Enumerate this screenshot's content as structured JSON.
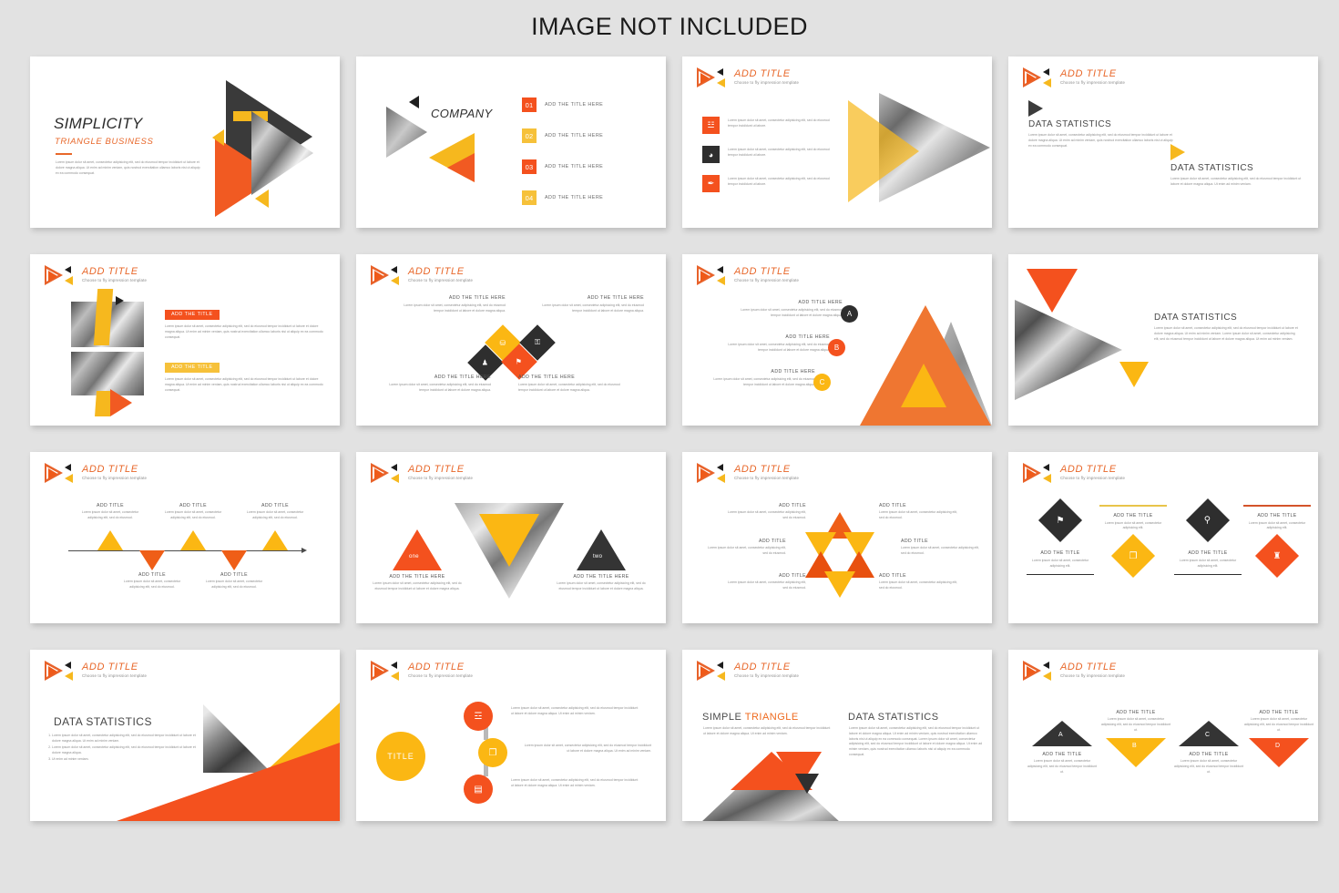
{
  "header": {
    "title": "IMAGE NOT INCLUDED"
  },
  "brand": {
    "logo_title": "ADD TITLE",
    "logo_sub": "Choose to fly impression template",
    "colors": {
      "orange": "#f4511e",
      "orange_light": "#ef7631",
      "yellow": "#fbb713",
      "yellow_soft": "#f6b81e",
      "dark": "#343434",
      "grey_text": "#8e8e8e",
      "slide_bg": "#ffffff",
      "page_bg": "#e2e2e2"
    }
  },
  "lorem": {
    "xs": "Lorem ipsum dolor sit amet, consectetur adipisicing elit, sed do eiusmod tempor incididunt ut labore et dolore magna aliqua.",
    "short": "Lorem ipsum dolor sit amet, consectetur adipisicing elit, sed do eiusmod.",
    "med": "Lorem ipsum dolor sit amet, consectetur adipisicing elit, sed do eiusmod tempor incididunt ut labore et dolore magna aliqua. Ut enim ad minim veniam.",
    "long": "Lorem ipsum dolor sit amet, consectetur adipisicing elit, sed do eiusmod tempor incididunt ut labore et dolore magna aliqua. Ut enim ad minim veniam, quis nostrud exercitation ullamco laboris nisi ut aliquip ex ea commodo consequat.",
    "tiny": "Lorem ipsum dolor sit amet, consectetur adipisicing elit, sed do eiusmod."
  },
  "slides": [
    {
      "id": "s1-title-slide",
      "title": "SIMPLICITY",
      "subtitle": "TRIANGLE BUSINESS",
      "body": "Lorem ipsum dolor sit amet, consectetur adipisicing elit, sed do eiusmod tempor incididunt ut labore et dolore magna aliqua. Ut enim ad minim veniam, quis nostrud exercitation ullamco laboris nisi ut aliquip ex ea commodo consequat."
    },
    {
      "id": "s2-company-agenda",
      "company": "COMPANY",
      "items": [
        {
          "num": "01",
          "label": "ADD THE TITLE HERE",
          "color": "#f4511e"
        },
        {
          "num": "02",
          "label": "ADD THE TITLE HERE",
          "color": "#f6c13a"
        },
        {
          "num": "03",
          "label": "ADD THE TITLE HERE",
          "color": "#f4511e"
        },
        {
          "num": "04",
          "label": "ADD THE TITLE HERE",
          "color": "#f6c13a"
        }
      ]
    },
    {
      "id": "s3-icon-list",
      "rows": [
        {
          "icon": "chart-icon",
          "glyph": "☳",
          "color": "#f4511e",
          "text": "Lorem ipsum dolor sit amet, consectetur adipisicing elit, sed do eiusmod tempor incididunt ut labore."
        },
        {
          "icon": "paint-bucket-icon",
          "glyph": "◕",
          "color": "#2e2e2e",
          "text": "Lorem ipsum dolor sit amet, consectetur adipisicing elit, sed do eiusmod tempor incididunt ut labore."
        },
        {
          "icon": "pen-icon",
          "glyph": "✒",
          "color": "#f4511e",
          "text": "Lorem ipsum dolor sit amet, consectetur adipisicing elit, sed do eiusmod tempor incididunt ut labore."
        }
      ]
    },
    {
      "id": "s4-data-statistics-dual",
      "block_a": {
        "heading": "DATA STATISTICS",
        "text": "Lorem ipsum dolor sit amet, consectetur adipisicing elit, sed do eiusmod tempor incididunt ut labore et dolore magna aliqua. Ut enim ad minim veniam, quis nostrud exercitation ullamco laboris nisi ut aliquip ex ea commodo consequat."
      },
      "block_b": {
        "heading": "DATA STATISTICS",
        "text": "Lorem ipsum dolor sit amet, consectetur adipisicing elit, sed do eiusmod tempor incididunt ut labore et dolore magna aliqua. Ut enim ad minim veniam."
      }
    },
    {
      "id": "s5-image-text",
      "blocks": [
        {
          "tag": "ADD THE TITLE",
          "tag_color": "#f4511e",
          "text": "Lorem ipsum dolor sit amet, consectetur adipisicing elit, sed do eiusmod tempor incididunt ut labore et dolore magna aliqua. Ut enim ad minim veniam, quis nostrud exercitation ullamco laboris nisi ut aliquip ex ea commodo consequat."
        },
        {
          "tag": "ADD THE TITLE",
          "tag_color": "#f6c13a",
          "text": "Lorem ipsum dolor sit amet, consectetur adipisicing elit, sed do eiusmod tempor incididunt ut labore et dolore magna aliqua. Ut enim ad minim veniam, quis nostrud exercitation ullamco laboris nisi ut aliquip ex ea commodo consequat."
        }
      ]
    },
    {
      "id": "s6-diamond-quad",
      "captions": [
        {
          "heading": "ADD THE TITLE HERE",
          "text": "Lorem ipsum dolor sit amet, consectetur adipisicing elit, sed do eiusmod tempor incididunt ut labore et dolore magna aliqua."
        },
        {
          "heading": "ADD THE TITLE HERE",
          "text": "Lorem ipsum dolor sit amet, consectetur adipisicing elit, sed do eiusmod tempor incididunt ut labore et dolore magna aliqua."
        },
        {
          "heading": "ADD THE TITLE HERE",
          "text": "Lorem ipsum dolor sit amet, consectetur adipisicing elit, sed do eiusmod tempor incididunt ut labore et dolore magna aliqua."
        },
        {
          "heading": "ADD THE TITLE HERE",
          "text": "Lorem ipsum dolor sit amet, consectetur adipisicing elit, sed do eiusmod tempor incididunt ut labore et dolore magna aliqua."
        }
      ],
      "diamonds": [
        {
          "icon": "briefcase-icon",
          "glyph": "⛁",
          "color": "#fbb713"
        },
        {
          "icon": "lock-icon",
          "glyph": "⚿",
          "color": "#2e2e2e"
        },
        {
          "icon": "user-icon",
          "glyph": "♟",
          "color": "#2e2e2e"
        },
        {
          "icon": "presentation-icon",
          "glyph": "⚑",
          "color": "#f4511e"
        }
      ]
    },
    {
      "id": "s7-abc-triangle",
      "rows": [
        {
          "badge": "A",
          "color": "#2e2e2e",
          "heading": "ADD TITLE HERE",
          "text": "Lorem ipsum dolor sit amet, consectetur adipisicing elit, sed do eiusmod tempor incididunt ut labore et dolore magna aliqua."
        },
        {
          "badge": "B",
          "color": "#f4511e",
          "heading": "ADD TITLE HERE",
          "text": "Lorem ipsum dolor sit amet, consectetur adipisicing elit, sed do eiusmod tempor incididunt ut labore et dolore magna aliqua."
        },
        {
          "badge": "C",
          "color": "#fbb713",
          "heading": "ADD TITLE HERE",
          "text": "Lorem ipsum dolor sit amet, consectetur adipisicing elit, sed do eiusmod tempor incididunt ut labore et dolore magna aliqua."
        }
      ]
    },
    {
      "id": "s8-data-statistics-photo",
      "heading": "DATA STATISTICS",
      "text": "Lorem ipsum dolor sit amet, consectetur adipisicing elit, sed do eiusmod tempor incididunt ut labore et dolore magna aliqua. Ut enim ad minim veniam. Lorem ipsum dolor sit amet, consectetur adipisicing elit, sed do eiusmod tempor incididunt ut labore et dolore magna aliqua. Ut enim ad minim veniam."
    },
    {
      "id": "s9-timeline",
      "above": [
        {
          "heading": "ADD TITLE",
          "text": "Lorem ipsum dolor sit amet, consectetur adipisicing elit, sed do eiusmod."
        },
        {
          "heading": "ADD TITLE",
          "text": "Lorem ipsum dolor sit amet, consectetur adipisicing elit, sed do eiusmod."
        },
        {
          "heading": "ADD TITLE",
          "text": "Lorem ipsum dolor sit amet, consectetur adipisicing elit, sed do eiusmod."
        }
      ],
      "below": [
        {
          "heading": "ADD TITLE",
          "text": "Lorem ipsum dolor sit amet, consectetur adipisicing elit, sed do eiusmod."
        },
        {
          "heading": "ADD TITLE",
          "text": "Lorem ipsum dolor sit amet, consectetur adipisicing elit, sed do eiusmod."
        }
      ]
    },
    {
      "id": "s10-one-two",
      "left": {
        "label": "one",
        "heading": "ADD THE TITLE HERE",
        "text": "Lorem ipsum dolor sit amet, consectetur adipisicing elit, sed do eiusmod tempor incididunt ut labore et dolore magna aliqua."
      },
      "right": {
        "label": "two",
        "heading": "ADD THE TITLE HERE",
        "text": "Lorem ipsum dolor sit amet, consectetur adipisicing elit, sed do eiusmod tempor incididunt ut labore et dolore magna aliqua."
      }
    },
    {
      "id": "s11-star-six",
      "left": [
        {
          "heading": "ADD TITLE",
          "text": "Lorem ipsum dolor sit amet, consectetur adipisicing elit, sed do eiusmod."
        },
        {
          "heading": "ADD TITLE",
          "text": "Lorem ipsum dolor sit amet, consectetur adipisicing elit, sed do eiusmod."
        },
        {
          "heading": "ADD TITLE",
          "text": "Lorem ipsum dolor sit amet, consectetur adipisicing elit, sed do eiusmod."
        }
      ],
      "right": [
        {
          "heading": "ADD TITLE",
          "text": "Lorem ipsum dolor sit amet, consectetur adipisicing elit, sed do eiusmod."
        },
        {
          "heading": "ADD TITLE",
          "text": "Lorem ipsum dolor sit amet, consectetur adipisicing elit, sed do eiusmod."
        },
        {
          "heading": "ADD TITLE",
          "text": "Lorem ipsum dolor sit amet, consectetur adipisicing elit, sed do eiusmod."
        }
      ]
    },
    {
      "id": "s12-diamond-row",
      "cells": [
        {
          "icon": "flag-icon",
          "glyph": "⚑",
          "dia_color": "#2e2e2e",
          "rule_color": "#2e2e2e",
          "heading": "ADD THE TITLE",
          "text": "Lorem ipsum dolor sit amet, consectetur adipisicing elit.",
          "orient": "up"
        },
        {
          "icon": "laptop-icon",
          "glyph": "❐",
          "dia_color": "#fbb713",
          "rule_color": "#e8c44a",
          "heading": "ADD THE TITLE",
          "text": "Lorem ipsum dolor sit amet, consectetur adipisicing elit.",
          "orient": "down"
        },
        {
          "icon": "search-icon",
          "glyph": "⚲",
          "dia_color": "#2e2e2e",
          "rule_color": "#2e2e2e",
          "heading": "ADD THE TITLE",
          "text": "Lorem ipsum dolor sit amet, consectetur adipisicing elit.",
          "orient": "up"
        },
        {
          "icon": "group-icon",
          "glyph": "♜",
          "dia_color": "#f4511e",
          "rule_color": "#d4542a",
          "heading": "ADD THE TITLE",
          "text": "Lorem ipsum dolor sit amet, consectetur adipisicing elit.",
          "orient": "down"
        }
      ]
    },
    {
      "id": "s13-data-statistics-list",
      "heading": "DATA STATISTICS",
      "items": [
        "Lorem ipsum dolor sit amet, consectetur adipisicing elit, sed do eiusmod tempor incididunt ut labore et dolore magna aliqua. Ut enim ad minim veniam.",
        "Lorem ipsum dolor sit amet, consectetur adipisicing elit, sed do eiusmod tempor incididunt ut labore et dolore magna aliqua.",
        "Ut enim ad minim veniam."
      ]
    },
    {
      "id": "s14-circle-title",
      "big_label": "TITLE",
      "rows": [
        {
          "icon": "bar-chart-icon",
          "glyph": "☲",
          "color": "#f4511e",
          "text": "Lorem ipsum dolor sit amet, consectetur adipisicing elit, sed do eiusmod tempor incididunt ut labore et dolore magna aliqua. Ut enim ad minim veniam."
        },
        {
          "icon": "laptop-icon",
          "glyph": "❐",
          "color": "#fbb713",
          "text": "Lorem ipsum dolor sit amet, consectetur adipisicing elit, sed do eiusmod tempor incididunt ut labore et dolore magna aliqua. Ut enim ad minim veniam."
        },
        {
          "icon": "report-icon",
          "glyph": "▤",
          "color": "#f4511e",
          "text": "Lorem ipsum dolor sit amet, consectetur adipisicing elit, sed do eiusmod tempor incididunt ut labore et dolore magna aliqua. Ut enim ad minim veniam."
        }
      ]
    },
    {
      "id": "s15-simple-triangle",
      "heading_plain": "SIMPLE ",
      "heading_accent": "TRIANGLE",
      "text_left": "Lorem ipsum dolor sit amet, consectetur adipisicing elit, sed do eiusmod tempor incididunt ut labore et dolore magna aliqua. Ut enim ad minim veniam.",
      "heading_right": "DATA STATISTICS",
      "text_right": "Lorem ipsum dolor sit amet, consectetur adipisicing elit, sed do eiusmod tempor incididunt ut labore et dolore magna aliqua. Ut enim ad minim veniam, quis nostrud exercitation ullamco laboris nisi ut aliquip ex ea commodo consequat. Lorem ipsum dolor sit amet, consectetur adipisicing elit, sed do eiusmod tempor incididunt ut labore et dolore magna aliqua. Ut enim ad minim veniam, quis nostrud exercitation ullamco laboris nisi ut aliquip ex ea commodo consequat."
    },
    {
      "id": "s16-abcd-triangles",
      "cells": [
        {
          "label": "A",
          "color": "#343434",
          "orient": "up",
          "heading": "ADD THE TITLE",
          "text": "Lorem ipsum dolor sit amet, consectetur adipisicing elit, sed do eiusmod tempor incididunt ut."
        },
        {
          "label": "B",
          "color": "#fbb713",
          "orient": "down",
          "heading": "ADD THE TITLE",
          "text": "Lorem ipsum dolor sit amet, consectetur adipisicing elit, sed do eiusmod tempor incididunt ut."
        },
        {
          "label": "C",
          "color": "#343434",
          "orient": "up",
          "heading": "ADD THE TITLE",
          "text": "Lorem ipsum dolor sit amet, consectetur adipisicing elit, sed do eiusmod tempor incididunt ut."
        },
        {
          "label": "D",
          "color": "#f4511e",
          "orient": "down",
          "heading": "ADD THE TITLE",
          "text": "Lorem ipsum dolor sit amet, consectetur adipisicing elit, sed do eiusmod tempor incididunt ut."
        }
      ]
    }
  ]
}
